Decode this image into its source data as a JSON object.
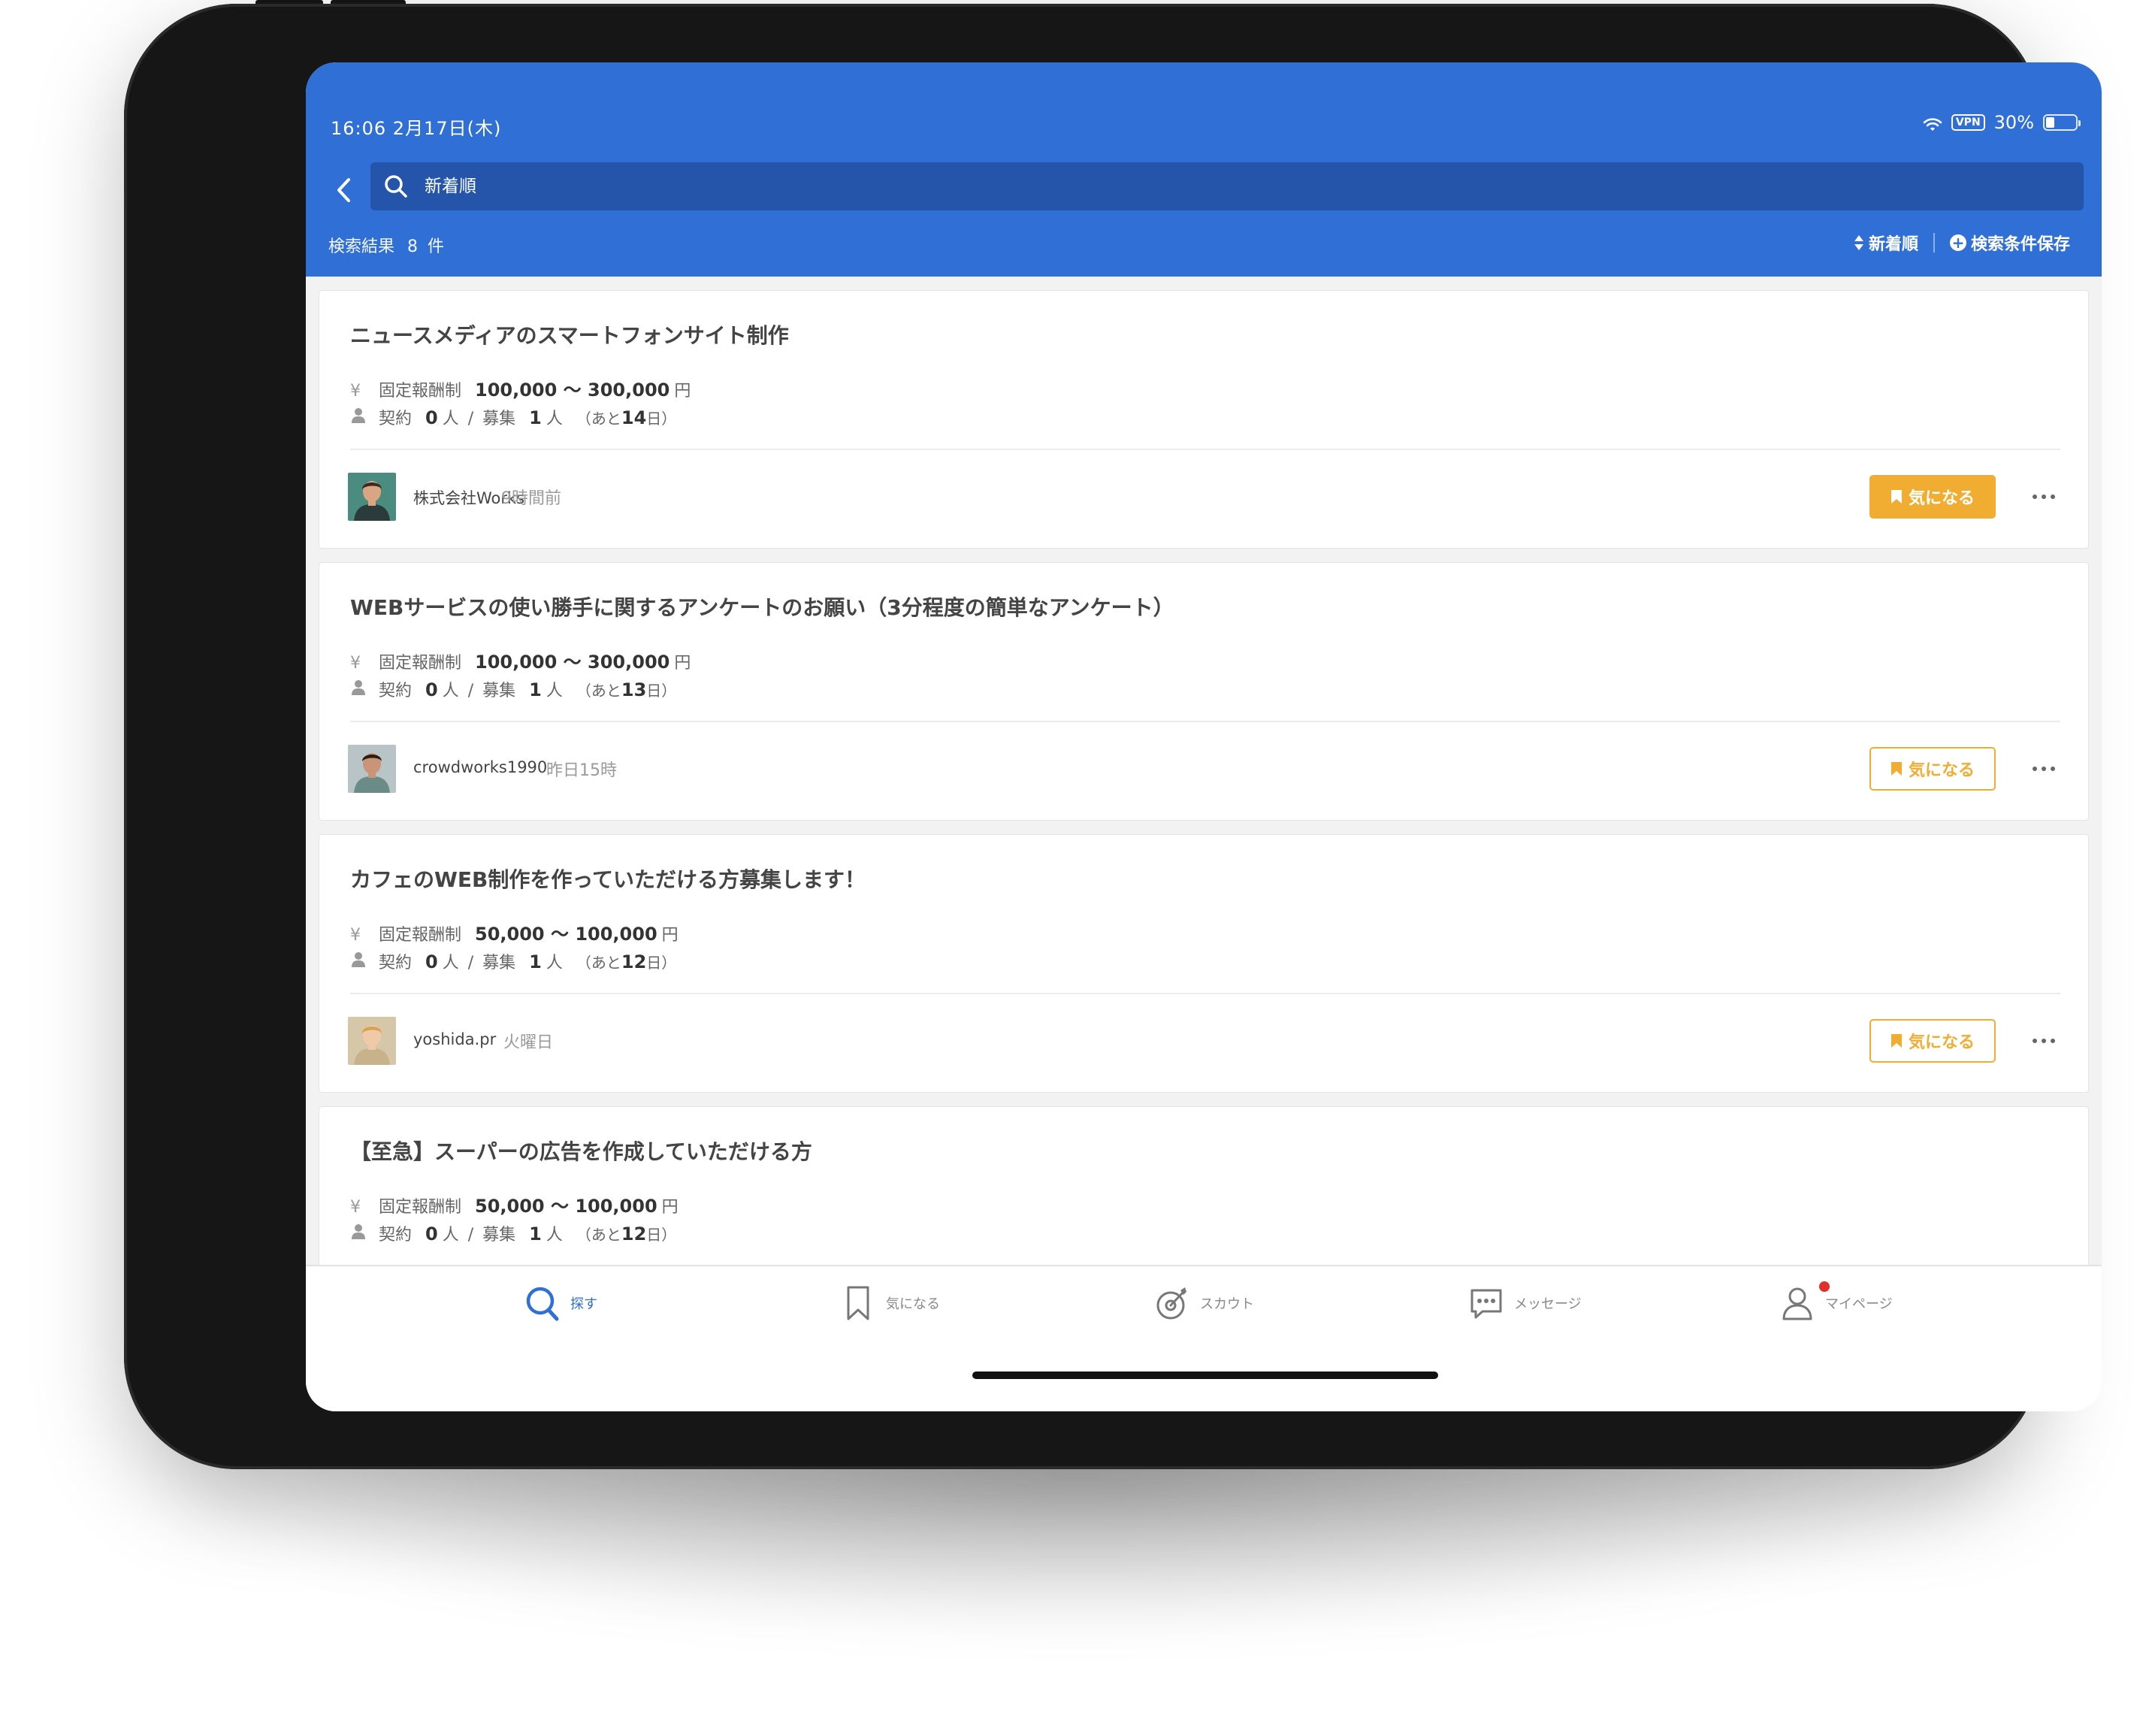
{
  "status_bar": {
    "time_date": "16:06   2月17日(木)",
    "vpn": "VPN",
    "battery": "30%",
    "battery_level": 0.3
  },
  "search": {
    "value": "",
    "placeholder": "新着順"
  },
  "results": {
    "label": "検索結果",
    "count": "8",
    "unit": "件"
  },
  "actions": {
    "sort": "新着順",
    "save_search": "検索条件保存"
  },
  "jobs": [
    {
      "title": "ニュースメディアのスマートフォンサイト制作",
      "pay_type": "固定報酬制",
      "pay_range": "100,000 〜 300,000",
      "currency": "円",
      "contract_label": "契約",
      "contracted": "0",
      "person_unit": "人",
      "recruit_label": "募集",
      "recruiting": "1",
      "remaining_prefix": "（あと",
      "remaining_days": "14",
      "remaining_suffix": "日）",
      "client": "株式会社Works",
      "posted": "9時間前",
      "watch_label": "気になる",
      "watched": true
    },
    {
      "title": "WEBサービスの使い勝手に関するアンケートのお願い（3分程度の簡単なアンケート）",
      "pay_type": "固定報酬制",
      "pay_range": "100,000 〜 300,000",
      "currency": "円",
      "contract_label": "契約",
      "contracted": "0",
      "person_unit": "人",
      "recruit_label": "募集",
      "recruiting": "1",
      "remaining_prefix": "（あと",
      "remaining_days": "13",
      "remaining_suffix": "日）",
      "client": "crowdworks1990",
      "posted": "昨日15時",
      "watch_label": "気になる",
      "watched": false
    },
    {
      "title": "カフェのWEB制作を作っていただける方募集します！",
      "pay_type": "固定報酬制",
      "pay_range": "50,000 〜 100,000",
      "currency": "円",
      "contract_label": "契約",
      "contracted": "0",
      "person_unit": "人",
      "recruit_label": "募集",
      "recruiting": "1",
      "remaining_prefix": "（あと",
      "remaining_days": "12",
      "remaining_suffix": "日）",
      "client": "yoshida.pr",
      "posted": "火曜日",
      "watch_label": "気になる",
      "watched": false
    },
    {
      "title": "【至急】スーパーの広告を作成していただける方",
      "pay_type": "固定報酬制",
      "pay_range": "50,000 〜 100,000",
      "currency": "円",
      "contract_label": "契約",
      "contracted": "0",
      "person_unit": "人",
      "recruit_label": "募集",
      "recruiting": "1",
      "remaining_prefix": "（あと",
      "remaining_days": "12",
      "remaining_suffix": "日）"
    }
  ],
  "tabs": [
    {
      "label": "探す",
      "icon": "search-icon",
      "active": true
    },
    {
      "label": "気になる",
      "icon": "bookmark-icon",
      "active": false
    },
    {
      "label": "スカウト",
      "icon": "target-icon",
      "active": false
    },
    {
      "label": "メッセージ",
      "icon": "chat-icon",
      "active": false
    },
    {
      "label": "マイページ",
      "icon": "user-icon",
      "active": false,
      "notification": true
    }
  ],
  "colors": {
    "primary": "#2f6fd6",
    "search_bar": "#2555ab",
    "accent": "#f0ad32",
    "notification": "#e0312b"
  }
}
